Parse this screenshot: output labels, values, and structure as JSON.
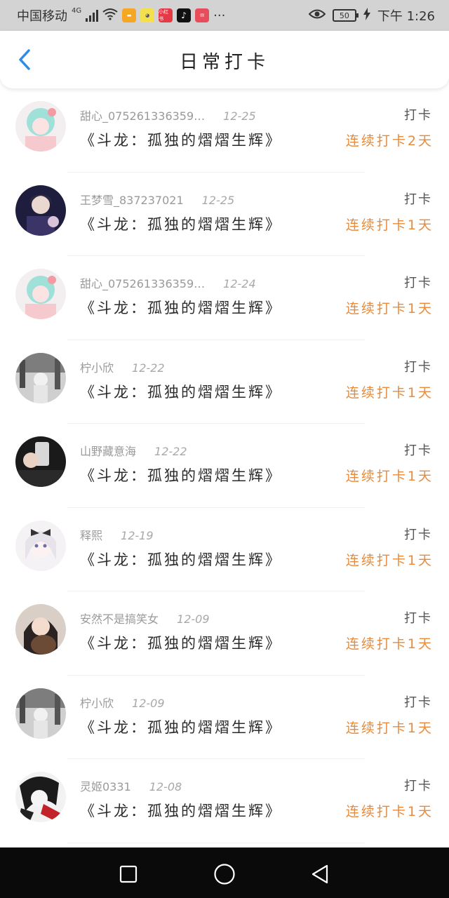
{
  "status_bar": {
    "carrier": "中国移动",
    "network": "4G",
    "battery": "50",
    "time": "下午 1:26",
    "more": "···",
    "icons": [
      "signal-icon",
      "wifi-icon",
      "app-icon-orange",
      "app-icon-yellow",
      "app-icon-red",
      "tiktok-icon",
      "app-icon-red2",
      "eye-icon",
      "battery-icon",
      "charging-icon"
    ],
    "apps": {
      "red_label": "小红书"
    }
  },
  "header": {
    "title": "日常打卡",
    "back_icon": "chevron-left-icon",
    "accent_color": "#2e8be6"
  },
  "colors": {
    "streak": "#e88a3a",
    "meta": "#9a9a9a"
  },
  "records": [
    {
      "user": "甜心_075261336359…",
      "date": "12-25",
      "book": "《斗龙：孤独的熠熠生辉》",
      "action": "打卡",
      "streak": "连续打卡2天"
    },
    {
      "user": "王梦雪_837237021",
      "date": "12-25",
      "book": "《斗龙：孤独的熠熠生辉》",
      "action": "打卡",
      "streak": "连续打卡1天"
    },
    {
      "user": "甜心_075261336359…",
      "date": "12-24",
      "book": "《斗龙：孤独的熠熠生辉》",
      "action": "打卡",
      "streak": "连续打卡1天"
    },
    {
      "user": "柠小欣",
      "date": "12-22",
      "book": "《斗龙：孤独的熠熠生辉》",
      "action": "打卡",
      "streak": "连续打卡1天"
    },
    {
      "user": "山野藏意海",
      "date": "12-22",
      "book": "《斗龙：孤独的熠熠生辉》",
      "action": "打卡",
      "streak": "连续打卡1天"
    },
    {
      "user": "释熙",
      "date": "12-19",
      "book": "《斗龙：孤独的熠熠生辉》",
      "action": "打卡",
      "streak": "连续打卡1天"
    },
    {
      "user": "安然不是搞笑女",
      "date": "12-09",
      "book": "《斗龙：孤独的熠熠生辉》",
      "action": "打卡",
      "streak": "连续打卡1天"
    },
    {
      "user": "柠小欣",
      "date": "12-09",
      "book": "《斗龙：孤独的熠熠生辉》",
      "action": "打卡",
      "streak": "连续打卡1天"
    },
    {
      "user": "灵姬0331",
      "date": "12-08",
      "book": "《斗龙：孤独的熠熠生辉》",
      "action": "打卡",
      "streak": "连续打卡1天"
    }
  ],
  "nav": {
    "icons": [
      "recent-apps-icon",
      "home-icon",
      "back-icon"
    ]
  }
}
